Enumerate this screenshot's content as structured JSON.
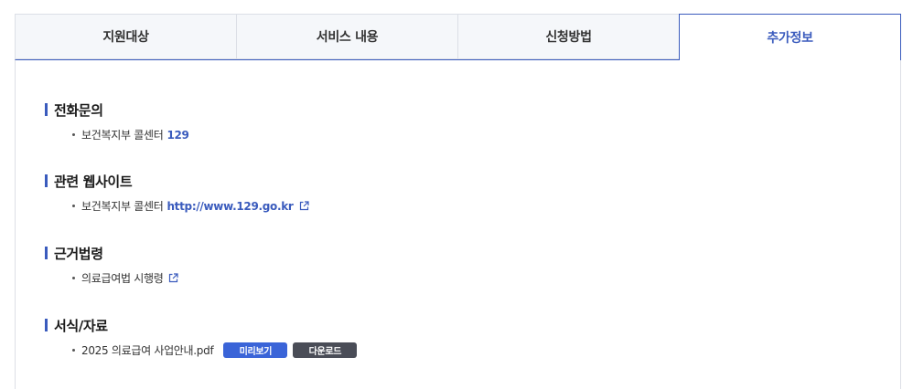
{
  "tabs": [
    {
      "label": "지원대상"
    },
    {
      "label": "서비스 내용"
    },
    {
      "label": "신청방법"
    },
    {
      "label": "추가정보"
    }
  ],
  "active_tab": "추가정보",
  "accent_color": "#3a5bbd",
  "sections": {
    "phone": {
      "title": "전화문의",
      "item_text": "보건복지부 콜센터",
      "item_link": "129"
    },
    "website": {
      "title": "관련 웹사이트",
      "item_text": "보건복지부 콜센터",
      "item_link": "http://www.129.go.kr",
      "icon": "external-link-icon"
    },
    "law": {
      "title": "근거법령",
      "item_text": "의료급여법 시행령",
      "icon": "external-link-icon"
    },
    "forms": {
      "title": "서식/자료",
      "file_name": "2025 의료급여 사업안내.pdf",
      "preview_label": "미리보기",
      "download_label": "다운로드"
    }
  }
}
